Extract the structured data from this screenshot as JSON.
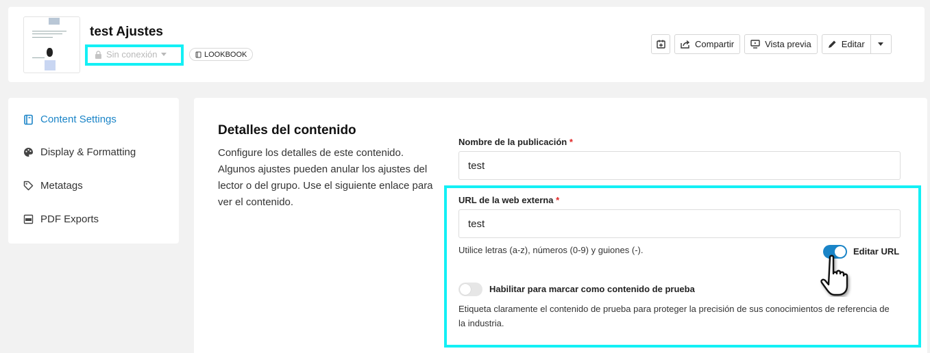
{
  "header": {
    "title": "test Ajustes",
    "status": "Sin conexión",
    "badge": "LOOKBOOK",
    "buttons": {
      "share": "Compartir",
      "preview": "Vista previa",
      "edit": "Editar"
    }
  },
  "sidebar": {
    "items": [
      {
        "label": "Content Settings",
        "icon": "book-icon",
        "active": true
      },
      {
        "label": "Display & Formatting",
        "icon": "palette-icon",
        "active": false
      },
      {
        "label": "Metatags",
        "icon": "tag-icon",
        "active": false
      },
      {
        "label": "PDF Exports",
        "icon": "pdf-icon",
        "active": false
      }
    ]
  },
  "main": {
    "section_title": "Detalles del contenido",
    "section_desc": "Configure los detalles de este contenido. Algunos ajustes pueden anular los ajustes del lector o del grupo. Use el siguiente enlace para ver el contenido.",
    "publication_name": {
      "label": "Nombre de la publicación",
      "required": "*",
      "value": "test"
    },
    "external_url": {
      "label": "URL de la web externa",
      "required": "*",
      "value": "test"
    },
    "hint": "Utilice letras (a-z), números (0-9) y guiones (-).",
    "edit_url": {
      "label": "Editar URL",
      "on": true
    },
    "test_content": {
      "label": "Habilitar para marcar como contenido de prueba",
      "on": false,
      "desc": "Etiqueta claramente el contenido de prueba para proteger la precisión de sus conocimientos de referencia de la industria."
    }
  },
  "colors": {
    "accent": "#1a84c7",
    "highlight": "#13f0f5",
    "required": "#e02424"
  }
}
